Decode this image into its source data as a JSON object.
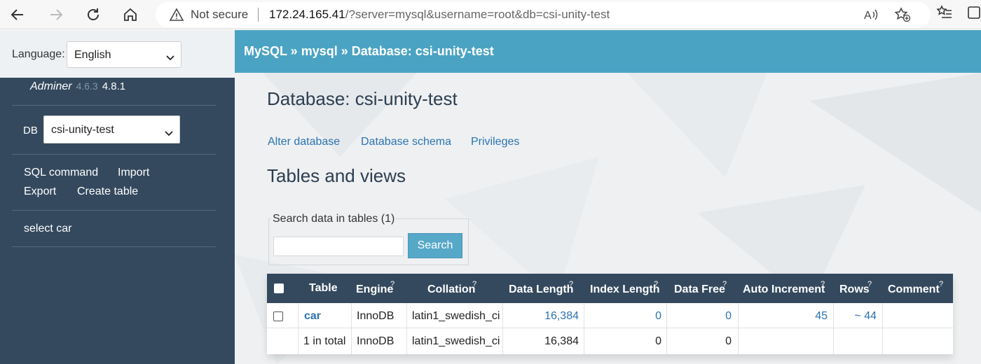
{
  "browser": {
    "not_secure": "Not secure",
    "url_host": "172.24.165.41",
    "url_rest": "/?server=mysql&username=root&db=csi-unity-test"
  },
  "language": {
    "label": "Language:",
    "selected": "English"
  },
  "breadcrumb": "MySQL » mysql » Database: csi-unity-test",
  "sidebar": {
    "brand": "Adminer",
    "old_version": "4.6.3",
    "new_version": "4.8.1",
    "db_label": "DB",
    "db_selected": "csi-unity-test",
    "links": {
      "sql_command": "SQL command",
      "import": "Import",
      "export": "Export",
      "create_table": "Create table",
      "select_car": "select car"
    }
  },
  "main": {
    "title": "Database: csi-unity-test",
    "tabs": [
      "Alter database",
      "Database schema",
      "Privileges"
    ],
    "section_title": "Tables and views",
    "search": {
      "legend": "Search data in tables (1)",
      "button": "Search",
      "value": ""
    }
  },
  "table": {
    "headers": [
      "Table",
      "Engine",
      "Collation",
      "Data Length",
      "Index Length",
      "Data Free",
      "Auto Increment",
      "Rows",
      "Comment"
    ],
    "help_mark": "?",
    "rows": [
      [
        "car",
        "InnoDB",
        "latin1_swedish_ci",
        "16,384",
        "0",
        "0",
        "45",
        "~ 44",
        ""
      ]
    ],
    "total": [
      "1 in total",
      "InnoDB",
      "latin1_swedish_ci",
      "16,384",
      "0",
      "0",
      "",
      "",
      ""
    ]
  },
  "colors": {
    "sidebar": "#34495e",
    "breadcrumb_bar": "#4ba3c3",
    "link": "#2b73b1",
    "search_button": "#56a8c9"
  }
}
